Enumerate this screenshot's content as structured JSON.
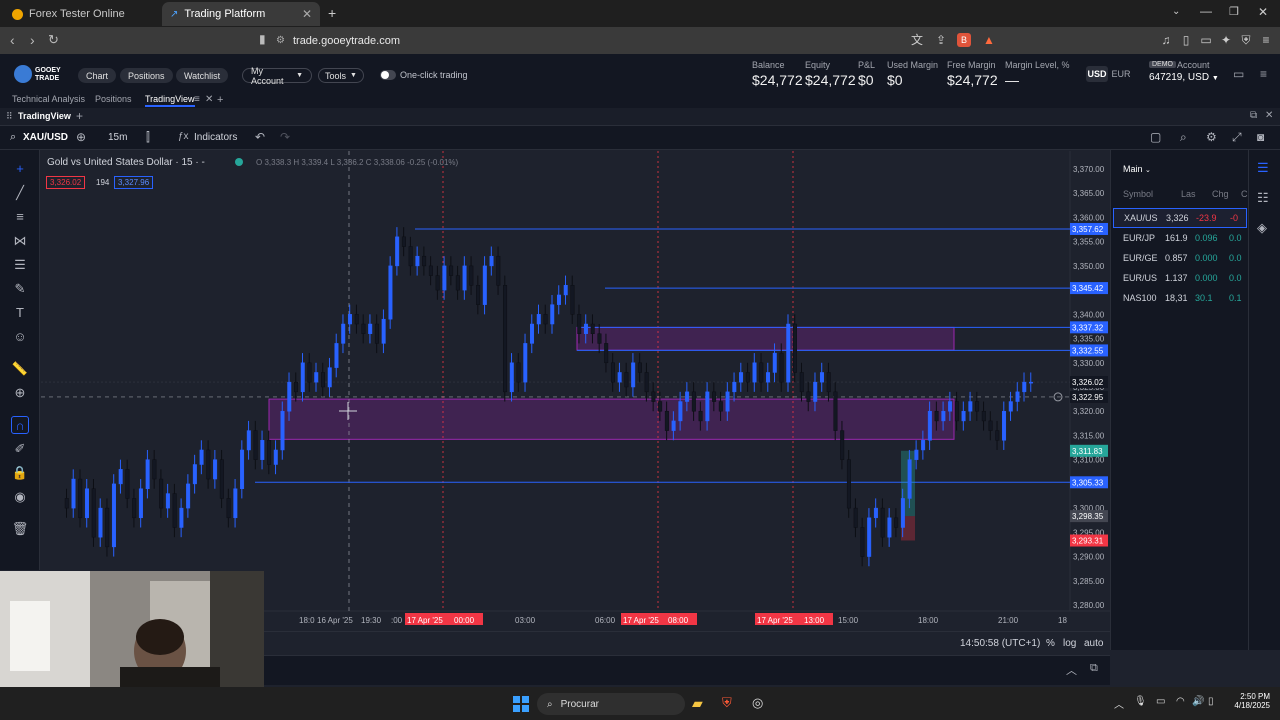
{
  "browser": {
    "tabs": [
      {
        "title": "Forex Tester Online"
      },
      {
        "title": "Trading Platform"
      }
    ],
    "url": "trade.gooeytrade.com"
  },
  "app": {
    "logo_line1": "GOOEY",
    "logo_line2": "TRADE",
    "nav": {
      "chart": "Chart",
      "positions": "Positions",
      "watchlist": "Watchlist",
      "my_account": "My Account",
      "tools": "Tools",
      "one_click": "One-click trading"
    },
    "stats": [
      {
        "label": "Balance",
        "value": "$24,772"
      },
      {
        "label": "Equity",
        "value": "$24,772"
      },
      {
        "label": "P&L",
        "value": "$0"
      },
      {
        "label": "Used Margin",
        "value": "$0"
      },
      {
        "label": "Free Margin",
        "value": "$24,772"
      },
      {
        "label": "Margin Level, %",
        "value": "—"
      }
    ],
    "currency_usd": "USD",
    "currency_eur": "EUR",
    "demo_badge": "DEMO",
    "account_label": "Account",
    "account_value": "647219, USD"
  },
  "subnav": {
    "technical_analysis": "Technical Analysis",
    "positions": "Positions",
    "tradingview": "TradingView"
  },
  "tvbar": {
    "title": "TradingView"
  },
  "toolbar": {
    "symbol": "XAU/USD",
    "interval": "15m",
    "indicators": "Indicators"
  },
  "chart": {
    "legend_title": "Gold vs United States Dollar · 15 · -",
    "ohlc": {
      "o_label": "O",
      "o": "3,338.3",
      "h_label": "H",
      "h": "3,339.4",
      "l_label": "L",
      "l": "3,336.2",
      "c_label": "C",
      "c": "3,338.06",
      "chg": "-0.25 (-0.01%)"
    },
    "sell_price": "3,326.02",
    "spread": "194",
    "buy_price": "3,327.96",
    "price_ticks": [
      "3,370.00",
      "3,365.00",
      "3,360.00",
      "3,355.00",
      "3,350.00",
      "3,345.00",
      "3,340.00",
      "3,335.00",
      "3,330.00",
      "3,325.00",
      "3,320.00",
      "3,315.00",
      "3,310.00",
      "3,305.00",
      "3,300.00",
      "3,295.00",
      "3,290.00",
      "3,285.00",
      "3,280.00"
    ],
    "time_ticks": [
      "18:0",
      "16 Apr '25",
      "19:30",
      ":00",
      "17 Apr '25",
      "00:00",
      "03:00",
      "06:00",
      "17 Apr '25",
      "08:00",
      "17 Apr '25",
      "13:00",
      "15:00",
      "18:00",
      "21:00",
      "18"
    ],
    "level_labels": [
      "3,357.62",
      "3,345.42",
      "3,337.32",
      "3,332.55",
      "3,326.02",
      "3,322.95",
      "3,311.83",
      "3,305.33",
      "3,298.35",
      "3,293.31"
    ],
    "bottom_time": "14:50:58 (UTC+1)",
    "pct": "%",
    "log": "log",
    "auto": "auto"
  },
  "watchlist": {
    "title": "Main",
    "headers": {
      "symbol": "Symbol",
      "last": "Las",
      "chg": "Chg",
      "chgp": "C"
    },
    "rows": [
      {
        "symbol": "XAU/US",
        "last": "3,326",
        "chg": "-23.9",
        "chgp": "-0"
      },
      {
        "symbol": "EUR/JP",
        "last": "161.9",
        "chg": "0.096",
        "chgp": "0.0"
      },
      {
        "symbol": "EUR/GE",
        "last": "0.857",
        "chg": "0.000",
        "chgp": "0.0"
      },
      {
        "symbol": "EUR/US",
        "last": "1.137",
        "chg": "0.000",
        "chgp": "0.0"
      },
      {
        "symbol": "NAS100",
        "last": "18,31",
        "chg": "30.1",
        "chgp": "0.1"
      }
    ]
  },
  "taskbar": {
    "search": "Procurar",
    "time": "2:50 PM",
    "date": "4/18/2025"
  }
}
